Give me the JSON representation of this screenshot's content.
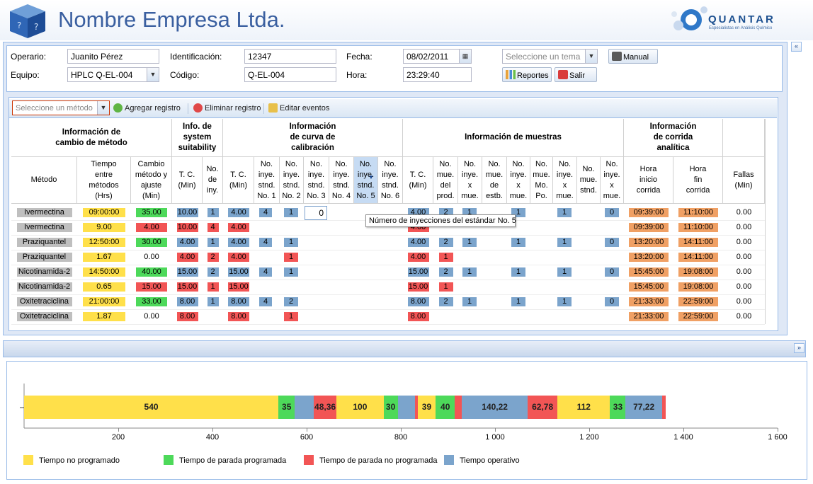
{
  "header": {
    "company": "Nombre Empresa Ltda.",
    "brand": "QUANTAR",
    "brand_tagline": "Especialistas en Análisis Químico"
  },
  "form": {
    "operario_label": "Operario:",
    "operario": "Juanito Pérez",
    "equipo_label": "Equipo:",
    "equipo": "HPLC Q-EL-004",
    "identificacion_label": "Identificación:",
    "identificacion": "12347",
    "codigo_label": "Código:",
    "codigo": "Q-EL-004",
    "fecha_label": "Fecha:",
    "fecha": "08/02/2011",
    "hora_label": "Hora:",
    "hora": "23:29:40",
    "tema_placeholder": "Seleccione un tema",
    "manual": "Manual",
    "reportes": "Reportes",
    "salir": "Salir"
  },
  "toolbar": {
    "metodo_placeholder": "Seleccione un método",
    "agregar": "Agregar registro",
    "eliminar": "Eliminar registro",
    "editar": "Editar eventos"
  },
  "group_headers": {
    "cambio": "Información de\ncambio de método",
    "system": "Info. de\nsystem\nsuitability",
    "curva": "Información\nde curva de\ncalibración",
    "muestras": "Información de muestras",
    "corrida": "Información\nde corrida\nanalítica"
  },
  "columns": [
    "Método",
    "Tiempo\nentre\nmétodos\n(Hrs)",
    "Cambio\nmétodo y\najuste\n(Min)",
    "T. C.\n(Min)",
    "No.\nde\niny.",
    "T. C.\n(Min)",
    "No.\ninye.\nstnd.\nNo. 1",
    "No.\ninye.\nstnd.\nNo. 2",
    "No.\ninye.\nstnd.\nNo. 3",
    "No.\ninye.\nstnd.\nNo. 4",
    "No.\ninye.\nstnd.\nNo. 5",
    "No.\ninye.\nstnd.\nNo. 6",
    "T. C.\n(Min)",
    "No.\nmue.\ndel\nprod.",
    "No.\ninye.\nx\nmue.",
    "No.\nmue.\nde\nestb.",
    "No.\ninye.\nx\nmue.",
    "No.\nmue.\nMo.\nPo.",
    "No.\ninye.\nx\nmue.",
    "No.\nmue.\nstnd.",
    "No.\ninye.\nx\nmue.",
    "Hora\ninicio\ncorrida",
    "Hora\nfin\ncorrida",
    "Fallas\n(Min)"
  ],
  "rows": [
    {
      "metodo": "Ivermectina",
      "tiempo": "09:00:00",
      "tiempo_c": "yel",
      "cambio": "35.00",
      "cambio_c": "grn",
      "ss_tc": "10.00",
      "ss_tc_c": "blu",
      "ss_iny": "1",
      "ss_iny_c": "blu",
      "cc_tc": "4.00",
      "cc_tc_c": "blu",
      "s1": "4",
      "s2": "1",
      "s3": "0",
      "s5": "",
      "m_tc": "4.00",
      "m_tc_c": "blu",
      "m1": "2",
      "m1_c": "blu",
      "m2": "1",
      "m4": "1",
      "m6": "1",
      "m8": "0",
      "inicio": "09:39:00",
      "fin": "11:10:00",
      "fallas": "0.00"
    },
    {
      "metodo": "Ivermectina",
      "tiempo": "9.00",
      "tiempo_c": "yel",
      "cambio": "4.00",
      "cambio_c": "red",
      "ss_tc": "10.00",
      "ss_tc_c": "red",
      "ss_iny": "4",
      "ss_iny_c": "red",
      "cc_tc": "4.00",
      "cc_tc_c": "red",
      "s1": "",
      "s2": "",
      "s3": "",
      "s5": "",
      "m_tc": "4.00",
      "m_tc_c": "red",
      "m1": "",
      "m1_c": "",
      "m2": "",
      "m4": "",
      "m6": "",
      "m8": "",
      "inicio": "09:39:00",
      "fin": "11:10:00",
      "fallas": "0.00"
    },
    {
      "metodo": "Praziquantel",
      "tiempo": "12:50:00",
      "tiempo_c": "yel",
      "cambio": "30.00",
      "cambio_c": "grn",
      "ss_tc": "4.00",
      "ss_tc_c": "blu",
      "ss_iny": "1",
      "ss_iny_c": "blu",
      "cc_tc": "4.00",
      "cc_tc_c": "blu",
      "s1": "4",
      "s2": "1",
      "s3": "",
      "s5": "",
      "m_tc": "4.00",
      "m_tc_c": "blu",
      "m1": "2",
      "m1_c": "blu",
      "m2": "1",
      "m4": "1",
      "m6": "1",
      "m8": "0",
      "inicio": "13:20:00",
      "fin": "14:11:00",
      "fallas": "0.00"
    },
    {
      "metodo": "Praziquantel",
      "tiempo": "1.67",
      "tiempo_c": "yel",
      "cambio": "0.00",
      "cambio_c": "",
      "ss_tc": "4.00",
      "ss_tc_c": "red",
      "ss_iny": "2",
      "ss_iny_c": "red",
      "cc_tc": "4.00",
      "cc_tc_c": "red",
      "s1": "",
      "s2": "1",
      "s3": "",
      "s5": "",
      "m_tc": "4.00",
      "m_tc_c": "red",
      "m1": "1",
      "m1_c": "red",
      "m2": "",
      "m4": "",
      "m6": "",
      "m8": "",
      "inicio": "13:20:00",
      "fin": "14:11:00",
      "fallas": "0.00"
    },
    {
      "metodo": "Nicotinamida-2",
      "tiempo": "14:50:00",
      "tiempo_c": "yel",
      "cambio": "40.00",
      "cambio_c": "grn",
      "ss_tc": "15.00",
      "ss_tc_c": "blu",
      "ss_iny": "2",
      "ss_iny_c": "blu",
      "cc_tc": "15.00",
      "cc_tc_c": "blu",
      "s1": "4",
      "s2": "1",
      "s3": "",
      "s5": "",
      "m_tc": "15.00",
      "m_tc_c": "blu",
      "m1": "2",
      "m1_c": "blu",
      "m2": "1",
      "m4": "1",
      "m6": "1",
      "m8": "0",
      "inicio": "15:45:00",
      "fin": "19:08:00",
      "fallas": "0.00"
    },
    {
      "metodo": "Nicotinamida-2",
      "tiempo": "0.65",
      "tiempo_c": "yel",
      "cambio": "15.00",
      "cambio_c": "red",
      "ss_tc": "15.00",
      "ss_tc_c": "red",
      "ss_iny": "1",
      "ss_iny_c": "red",
      "cc_tc": "15.00",
      "cc_tc_c": "red",
      "s1": "",
      "s2": "",
      "s3": "",
      "s5": "",
      "m_tc": "15.00",
      "m_tc_c": "red",
      "m1": "1",
      "m1_c": "red",
      "m2": "",
      "m4": "",
      "m6": "",
      "m8": "",
      "inicio": "15:45:00",
      "fin": "19:08:00",
      "fallas": "0.00"
    },
    {
      "metodo": "Oxitetraciclina",
      "tiempo": "21:00:00",
      "tiempo_c": "yel",
      "cambio": "33.00",
      "cambio_c": "grn",
      "ss_tc": "8.00",
      "ss_tc_c": "blu",
      "ss_iny": "1",
      "ss_iny_c": "blu",
      "cc_tc": "8.00",
      "cc_tc_c": "blu",
      "s1": "4",
      "s2": "2",
      "s3": "",
      "s5": "",
      "m_tc": "8.00",
      "m_tc_c": "blu",
      "m1": "2",
      "m1_c": "blu",
      "m2": "1",
      "m4": "1",
      "m6": "1",
      "m8": "0",
      "inicio": "21:33:00",
      "fin": "22:59:00",
      "fallas": "0.00"
    },
    {
      "metodo": "Oxitetraciclina",
      "tiempo": "1.87",
      "tiempo_c": "yel",
      "cambio": "0.00",
      "cambio_c": "",
      "ss_tc": "8.00",
      "ss_tc_c": "red",
      "ss_iny": "",
      "ss_iny_c": "",
      "cc_tc": "8.00",
      "cc_tc_c": "red",
      "s1": "",
      "s2": "1",
      "s3": "",
      "s5": "",
      "m_tc": "8.00",
      "m_tc_c": "red",
      "m1": "",
      "m1_c": "",
      "m2": "",
      "m4": "",
      "m6": "",
      "m8": "",
      "inicio": "21:33:00",
      "fin": "22:59:00",
      "fallas": "0.00"
    }
  ],
  "tooltip": "Número de inyecciones del estándar No. 5",
  "colors": {
    "yellow": "#ffe04a",
    "green": "#4dd95a",
    "red": "#f25555",
    "blue": "#7ba4cc",
    "orange": "#f0a064",
    "gray": "#bfbfbf"
  },
  "chart_data": {
    "type": "bar",
    "orientation": "horizontal-stacked",
    "xlim": [
      0,
      1600
    ],
    "x_ticks": [
      "200",
      "400",
      "600",
      "800",
      "1 000",
      "1 200",
      "1 400",
      "1 600"
    ],
    "segments": [
      {
        "series": "Tiempo no programado",
        "value": 540,
        "label": "540"
      },
      {
        "series": "Tiempo de parada programada",
        "value": 35,
        "label": "35"
      },
      {
        "series": "Tiempo operativo",
        "value": 40,
        "label": ""
      },
      {
        "series": "Tiempo de parada no programada",
        "value": 48.36,
        "label": "48,36"
      },
      {
        "series": "Tiempo no programado",
        "value": 100,
        "label": "100"
      },
      {
        "series": "Tiempo de parada programada",
        "value": 30,
        "label": "30"
      },
      {
        "series": "Tiempo operativo",
        "value": 37,
        "label": ""
      },
      {
        "series": "Tiempo de parada no programada",
        "value": 5,
        "label": ""
      },
      {
        "series": "Tiempo no programado",
        "value": 39,
        "label": "39"
      },
      {
        "series": "Tiempo de parada programada",
        "value": 40,
        "label": "40"
      },
      {
        "series": "Tiempo de parada no programada",
        "value": 15,
        "label": ""
      },
      {
        "series": "Tiempo operativo",
        "value": 140.22,
        "label": "140,22"
      },
      {
        "series": "Tiempo de parada no programada",
        "value": 62.78,
        "label": "62,78"
      },
      {
        "series": "Tiempo no programado",
        "value": 112,
        "label": "112"
      },
      {
        "series": "Tiempo de parada programada",
        "value": 33,
        "label": "33"
      },
      {
        "series": "Tiempo operativo",
        "value": 77.22,
        "label": "77,22"
      },
      {
        "series": "Tiempo de parada no programada",
        "value": 8,
        "label": ""
      }
    ],
    "legend": [
      "Tiempo no programado",
      "Tiempo de parada programada",
      "Tiempo de parada no programada",
      "Tiempo operativo"
    ],
    "legend_position": "bottom"
  }
}
